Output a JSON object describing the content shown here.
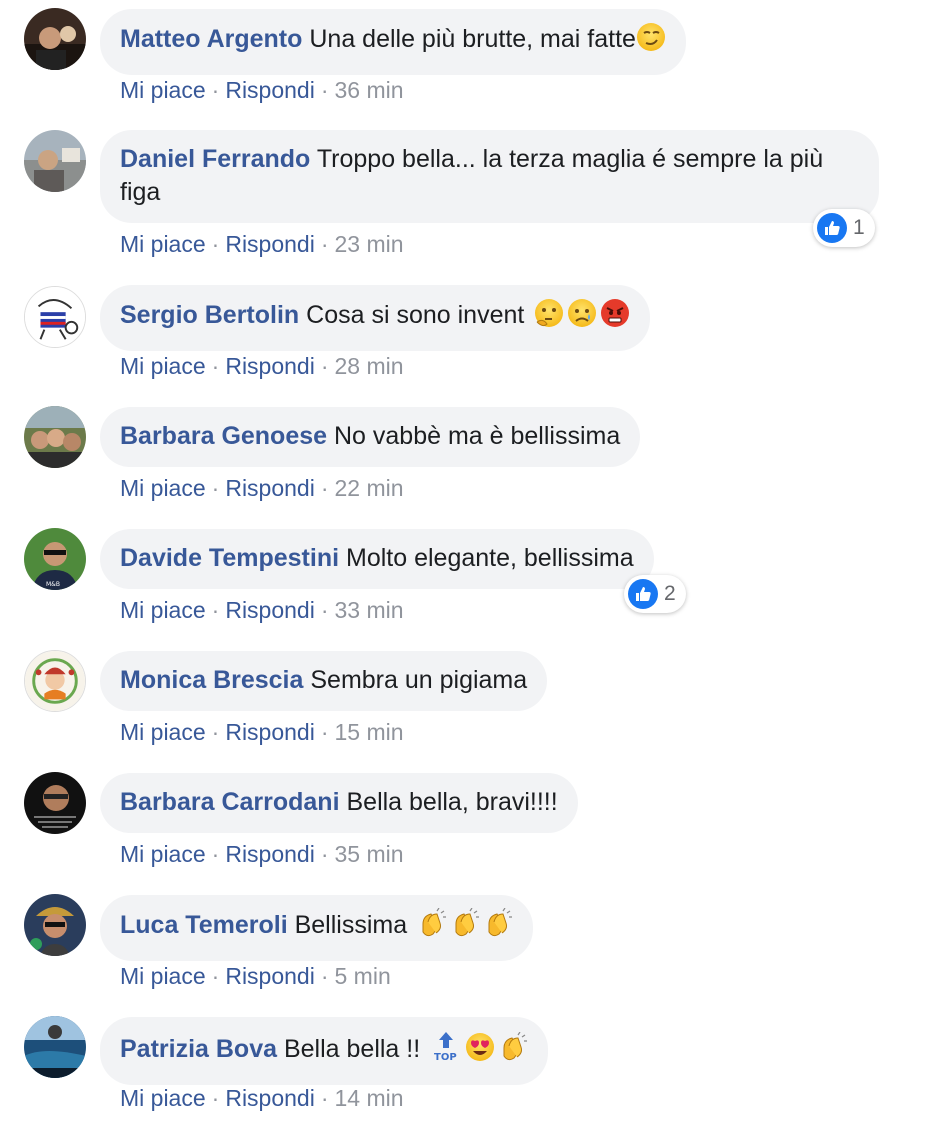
{
  "actions": {
    "like_label": "Mi piace",
    "reply_label": "Rispondi",
    "separator": "·"
  },
  "colors": {
    "author": "#385898",
    "bubble": "#f2f3f5",
    "meta": "#90949c",
    "like_badge": "#1877f2"
  },
  "comments": [
    {
      "author": "Matteo Argento",
      "text": "Una delle più brutte, mai fatte",
      "emojis": [
        "smirking-face"
      ],
      "time": "36 min"
    },
    {
      "author": "Daniel Ferrando",
      "text": "Troppo bella... la terza maglia é sempre la più figa",
      "reactions": {
        "type": "like",
        "count": "1"
      },
      "time": "23 min"
    },
    {
      "author": "Sergio Bertolin",
      "text": "Cosa si sono invent",
      "emojis": [
        "thinking-face",
        "sad-tear-face",
        "angry-face"
      ],
      "time": "28 min"
    },
    {
      "author": "Barbara Genoese",
      "text": "No vabbè ma è bellissima",
      "time": "22 min"
    },
    {
      "author": "Davide Tempestini",
      "text": "Molto elegante, bellissima",
      "reactions": {
        "type": "like",
        "count": "2"
      },
      "time": "33 min"
    },
    {
      "author": "Monica Brescia",
      "text": "Sembra un pigiama",
      "time": "15 min"
    },
    {
      "author": "Barbara Carrodani",
      "text": "Bella bella, bravi!!!!",
      "time": "35 min"
    },
    {
      "author": "Luca Temeroli",
      "text": "Bellissima",
      "emojis": [
        "clapping-hands",
        "clapping-hands",
        "clapping-hands"
      ],
      "time": "5 min"
    },
    {
      "author": "Patrizia Bova",
      "text": "Bella bella !!",
      "emojis": [
        "top-arrow",
        "heart-eyes-face",
        "clapping-hands"
      ],
      "time": "14 min"
    }
  ]
}
